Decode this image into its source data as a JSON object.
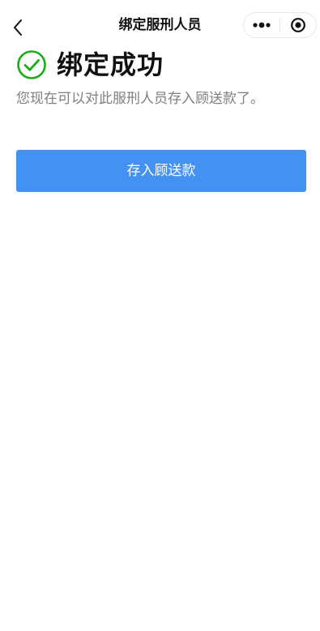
{
  "navbar": {
    "title": "绑定服刑人员"
  },
  "result": {
    "title": "绑定成功",
    "description": "您现在可以对此服刑人员存入顾送款了。"
  },
  "actions": {
    "deposit_label": "存入顾送款"
  },
  "colors": {
    "success_green": "#1aad19",
    "primary_blue": "#4392f1",
    "description_gray": "#7f7f7f"
  }
}
